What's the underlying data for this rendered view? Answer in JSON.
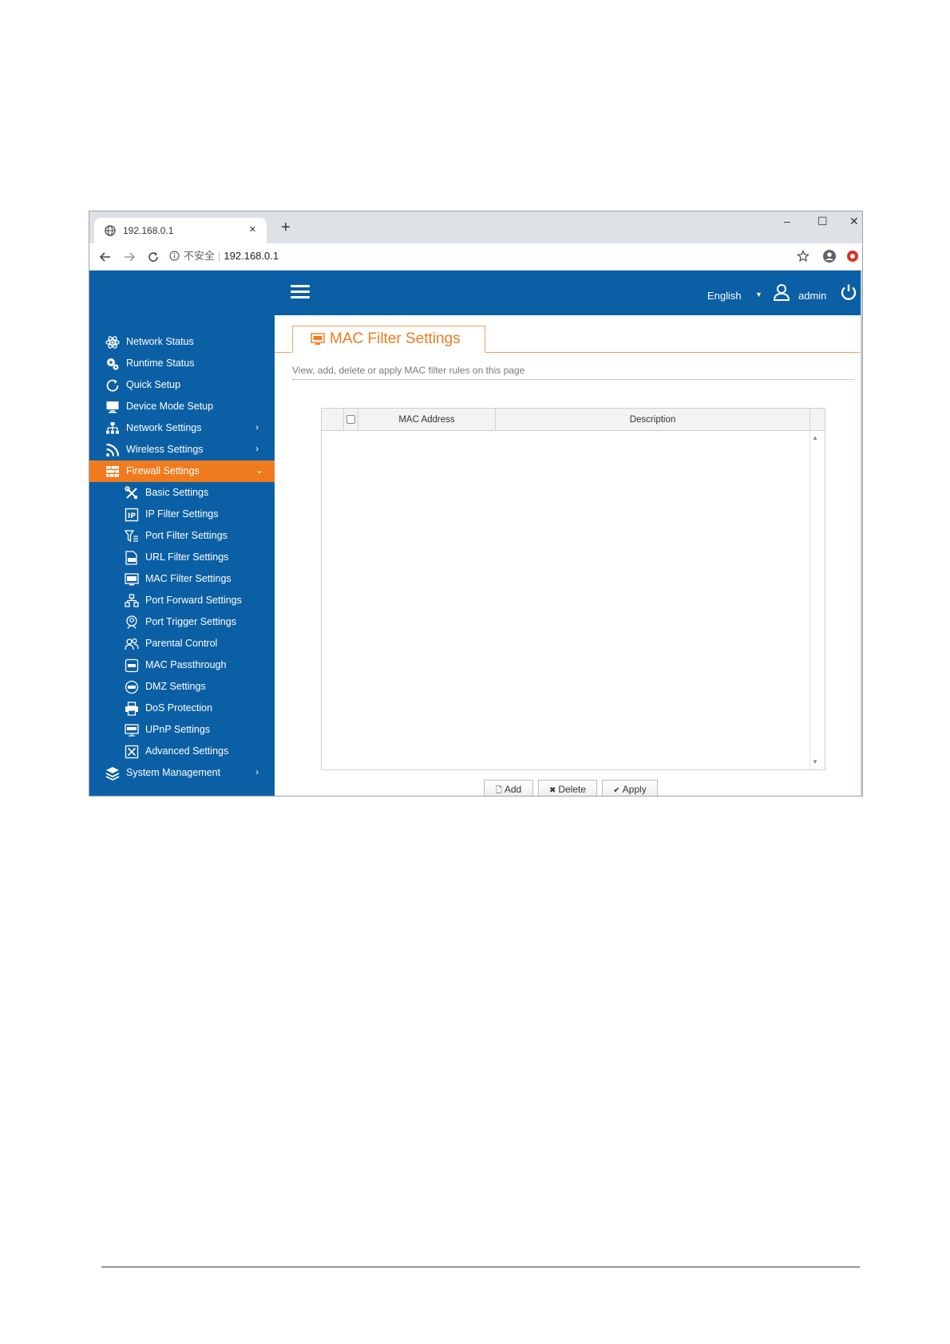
{
  "browser": {
    "tab_title": "192.168.0.1",
    "tab_close": "×",
    "new_tab": "+",
    "minimize": "–",
    "maximize": "☐",
    "close": "✕",
    "insecure_label": "不安全",
    "url": "192.168.0.1"
  },
  "header": {
    "language": "English",
    "user": "admin"
  },
  "sidebar": {
    "items": [
      {
        "label": "Network Status"
      },
      {
        "label": "Runtime Status"
      },
      {
        "label": "Quick Setup"
      },
      {
        "label": "Device Mode Setup"
      },
      {
        "label": "Network Settings"
      },
      {
        "label": "Wireless Settings"
      },
      {
        "label": "Firewall Settings"
      },
      {
        "label": "Basic Settings"
      },
      {
        "label": "IP Filter Settings"
      },
      {
        "label": "Port Filter Settings"
      },
      {
        "label": "URL Filter Settings"
      },
      {
        "label": "MAC Filter Settings"
      },
      {
        "label": "Port Forward Settings"
      },
      {
        "label": "Port Trigger Settings"
      },
      {
        "label": "Parental Control"
      },
      {
        "label": "MAC Passthrough"
      },
      {
        "label": "DMZ Settings"
      },
      {
        "label": "DoS Protection"
      },
      {
        "label": "UPnP Settings"
      },
      {
        "label": "Advanced Settings"
      },
      {
        "label": "System Management"
      }
    ]
  },
  "main": {
    "title": "MAC Filter Settings",
    "description": "View, add, delete or apply MAC filter rules on this page",
    "table": {
      "columns": [
        "MAC Address",
        "Description"
      ],
      "rows": []
    },
    "buttons": {
      "add": "Add",
      "delete": "Delete",
      "apply": "Apply"
    }
  },
  "colors": {
    "brand_blue": "#0b5fa5",
    "accent_orange": "#f07b1f"
  }
}
